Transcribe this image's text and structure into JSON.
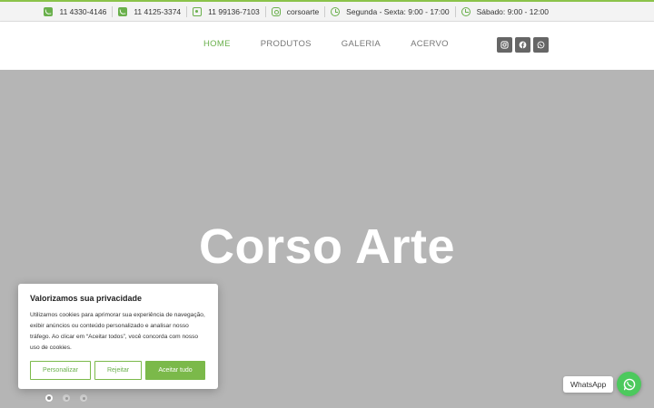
{
  "topbar": {
    "phone1": "11 4330-4146",
    "phone2": "11 4125-3374",
    "whatsapp": "11 99136-7103",
    "instagram": "corsoarte",
    "hours_week": "Segunda - Sexta: 9:00 - 17:00",
    "hours_sat": "Sábado: 9:00 - 12:00"
  },
  "nav": {
    "items": [
      {
        "label": "HOME",
        "active": true
      },
      {
        "label": "PRODUTOS",
        "active": false
      },
      {
        "label": "GALERIA",
        "active": false
      },
      {
        "label": "ACERVO",
        "active": false
      }
    ]
  },
  "social_icons": [
    "instagram-icon",
    "facebook-icon",
    "whatsapp-icon"
  ],
  "hero": {
    "title": "Corso Arte",
    "slides": 3,
    "active_slide": 1
  },
  "cookie": {
    "title": "Valorizamos sua privacidade",
    "text": "Utilizamos cookies para aprimorar sua experiência de navegação, exibir anúncios ou conteúdo personalizado e analisar nosso tráfego. Ao clicar em “Aceitar todos”, você concorda com nosso uso de cookies.",
    "customize_label": "Personalizar",
    "reject_label": "Rejeitar",
    "accept_label": "Aceitar tudo"
  },
  "whatsapp_widget": {
    "label": "WhatsApp"
  },
  "colors": {
    "accent": "#6ab04c",
    "hero_bg": "#b5b5b5",
    "whatsapp": "#4cc95d"
  }
}
